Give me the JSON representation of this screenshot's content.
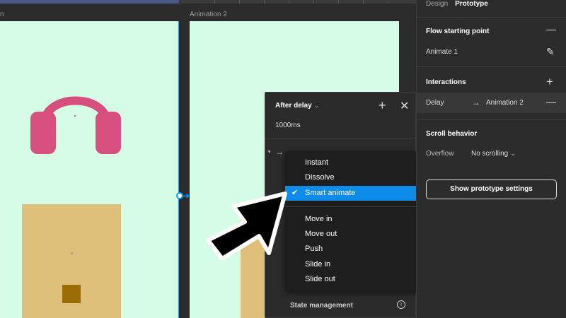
{
  "canvas": {
    "frame1_label": "n",
    "frame2_label": "Animation 2"
  },
  "popup": {
    "trigger_label": "After delay",
    "trigger_chevron": "⌄",
    "delay_value": "1000ms",
    "state_management_label": "State management"
  },
  "menu": {
    "items": [
      {
        "label": "Instant",
        "selected": false
      },
      {
        "label": "Dissolve",
        "selected": false
      },
      {
        "label": "Smart animate",
        "selected": true
      }
    ],
    "items2": [
      {
        "label": "Move in"
      },
      {
        "label": "Move out"
      },
      {
        "label": "Push"
      },
      {
        "label": "Slide in"
      },
      {
        "label": "Slide out"
      }
    ]
  },
  "panel": {
    "tabs": {
      "design": "Design",
      "prototype": "Prototype"
    },
    "flow_title": "Flow starting point",
    "flow_name": "Animate 1",
    "interactions_title": "Interactions",
    "interaction_trigger": "Delay",
    "interaction_target": "Animation 2",
    "scroll_title": "Scroll behavior",
    "overflow_label": "Overflow",
    "overflow_value": "No scrolling",
    "settings_button": "Show prototype settings"
  },
  "colors": {
    "frame_bg": "#d5fde6",
    "headphones": "#d64f7e",
    "box": "#dfc07a",
    "box_inner": "#9b6e05",
    "accent": "#0d8ce9"
  },
  "icons": [
    "plus-icon",
    "close-icon",
    "arrow-right-icon",
    "check-icon",
    "info-icon",
    "minus-icon",
    "edit-icon",
    "chevron-down-icon",
    "pointer-cursor-icon"
  ]
}
